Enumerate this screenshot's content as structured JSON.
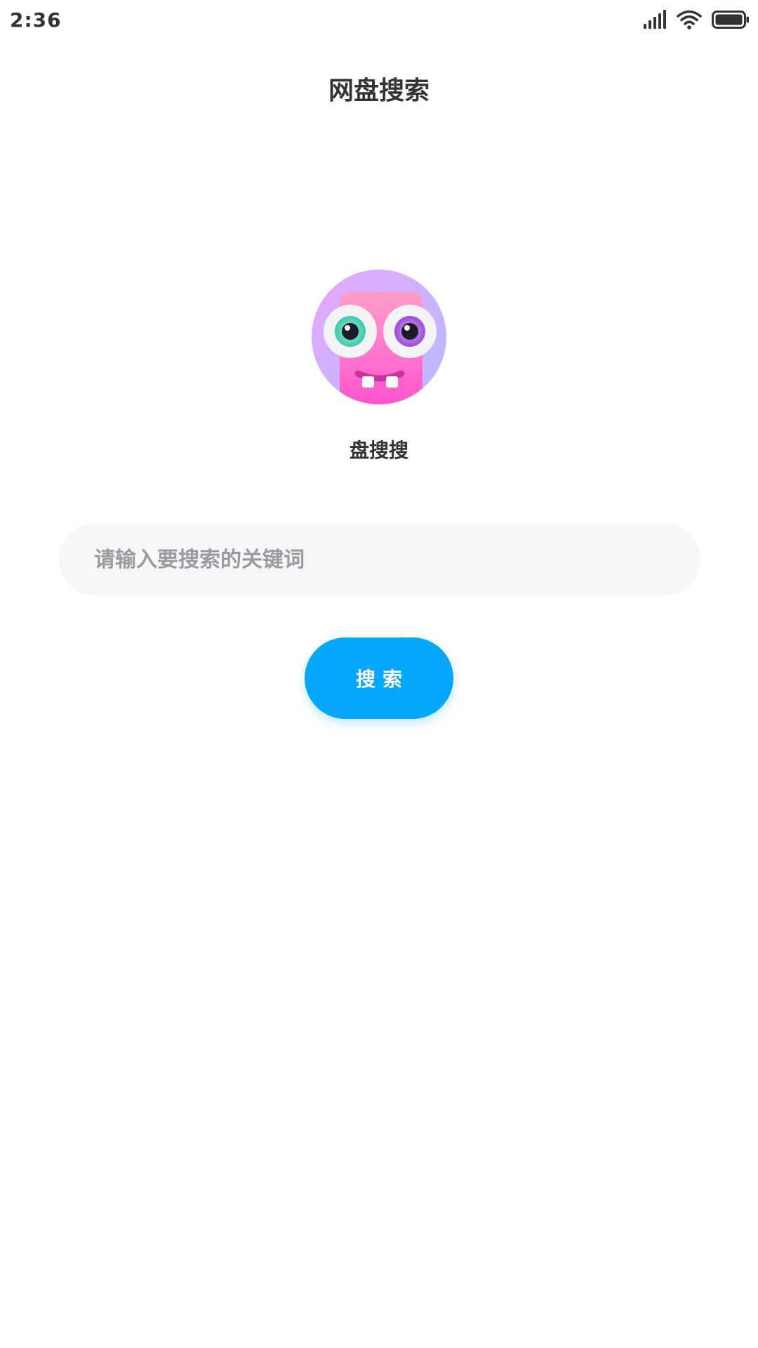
{
  "status_bar": {
    "time": "2:36",
    "icons": [
      "signal-icon",
      "wifi-icon",
      "battery-icon"
    ]
  },
  "header": {
    "title": "网盘搜索"
  },
  "app": {
    "logo_icon": "monster-logo-icon",
    "name": "盘搜搜"
  },
  "search": {
    "placeholder": "请输入要搜索的关键词",
    "value": "",
    "button_label": "搜索"
  },
  "colors": {
    "accent": "#04a7fb",
    "input_bg": "#f7f7f7",
    "placeholder": "#9a9aa2",
    "text": "#333333"
  }
}
